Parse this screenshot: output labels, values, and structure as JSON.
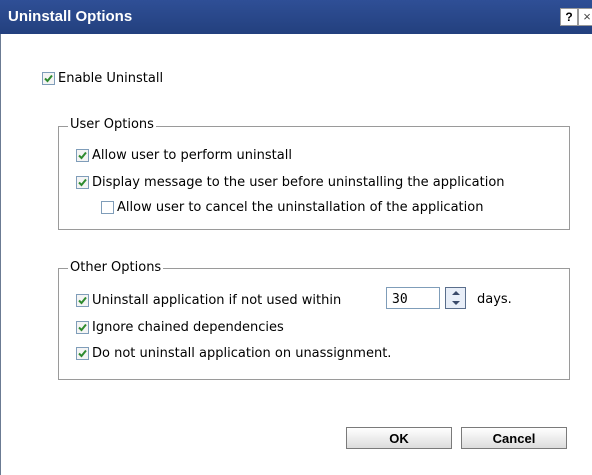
{
  "dialog": {
    "title": "Uninstall Options",
    "help_label": "?",
    "close_label": "×"
  },
  "enable_uninstall": {
    "label": "Enable Uninstall",
    "checked": true
  },
  "user_options": {
    "legend": "User Options",
    "allow_uninstall": {
      "label": "Allow user to perform uninstall",
      "checked": true
    },
    "display_message": {
      "label": "Display message to the user before uninstalling the application",
      "checked": true
    },
    "allow_cancel": {
      "label": "Allow user to cancel the uninstallation of the application",
      "checked": false
    }
  },
  "other_options": {
    "legend": "Other Options",
    "uninstall_if_unused": {
      "label": "Uninstall application if not used within",
      "checked": true
    },
    "days_value": "30",
    "days_label": "days.",
    "ignore_chained": {
      "label": "Ignore chained dependencies",
      "checked": true
    },
    "no_uninstall_unassign": {
      "label": "Do not uninstall application on unassignment.",
      "checked": true
    }
  },
  "buttons": {
    "ok": "OK",
    "cancel": "Cancel"
  },
  "colors": {
    "titlebar": "#23407e",
    "check": "#2e8b2e"
  }
}
